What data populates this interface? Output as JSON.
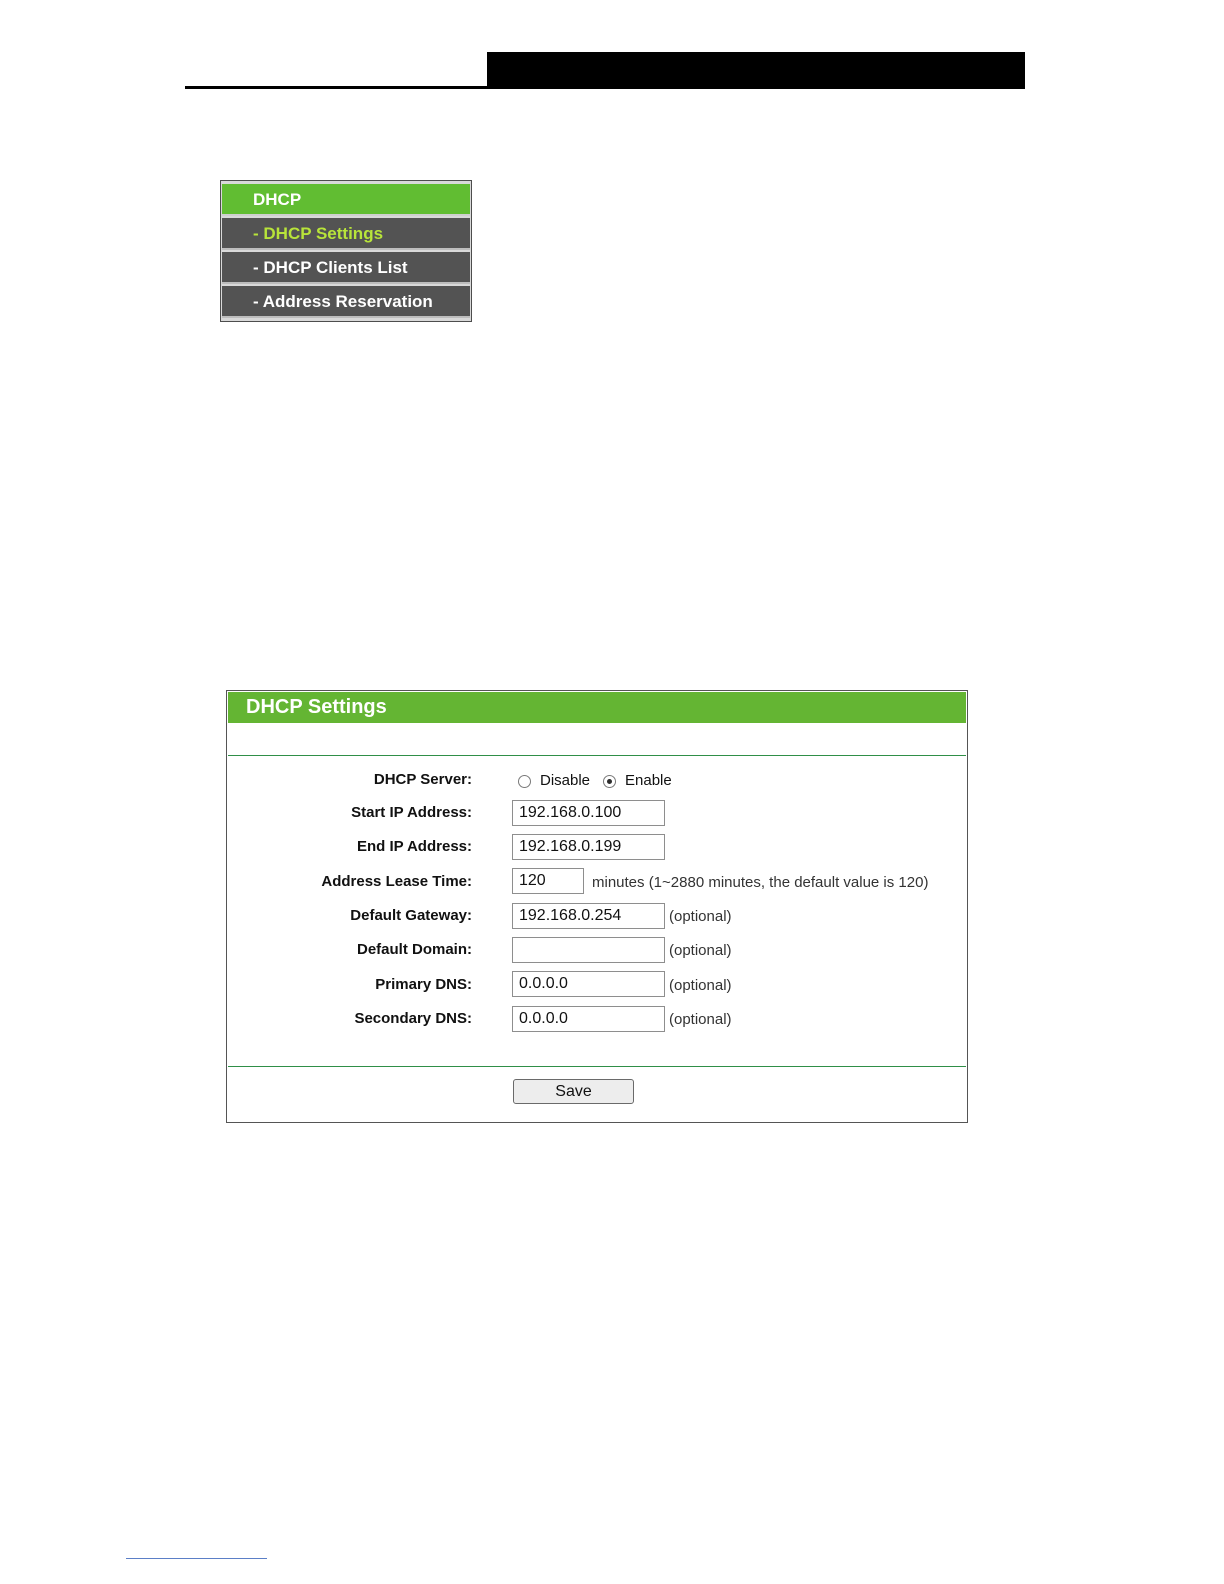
{
  "menu": {
    "header": "DHCP",
    "items": [
      {
        "label": "- DHCP Settings",
        "active": true
      },
      {
        "label": "- DHCP Clients List",
        "active": false
      },
      {
        "label": "- Address Reservation",
        "active": false
      }
    ]
  },
  "panel": {
    "title": "DHCP Settings",
    "dhcp_server": {
      "label": "DHCP Server:",
      "options": [
        "Disable",
        "Enable"
      ],
      "selected": "Enable"
    },
    "start_ip": {
      "label": "Start IP Address:",
      "value": "192.168.0.100"
    },
    "end_ip": {
      "label": "End IP Address:",
      "value": "192.168.0.199"
    },
    "lease_time": {
      "label": "Address Lease Time:",
      "value": "120",
      "hint": "minutes (1~2880 minutes, the default value is 120)"
    },
    "default_gateway": {
      "label": "Default Gateway:",
      "value": "192.168.0.254",
      "hint": "(optional)"
    },
    "default_domain": {
      "label": "Default Domain:",
      "value": "",
      "hint": "(optional)"
    },
    "primary_dns": {
      "label": "Primary DNS:",
      "value": "0.0.0.0",
      "hint": "(optional)"
    },
    "secondary_dns": {
      "label": "Secondary DNS:",
      "value": "0.0.0.0",
      "hint": "(optional)"
    },
    "save_label": "Save"
  },
  "colors": {
    "menu_green": "#61bd32",
    "menu_gray": "#535353",
    "active_text": "#b8e43a",
    "panel_green": "#64b533",
    "separator": "#2f8f47"
  }
}
